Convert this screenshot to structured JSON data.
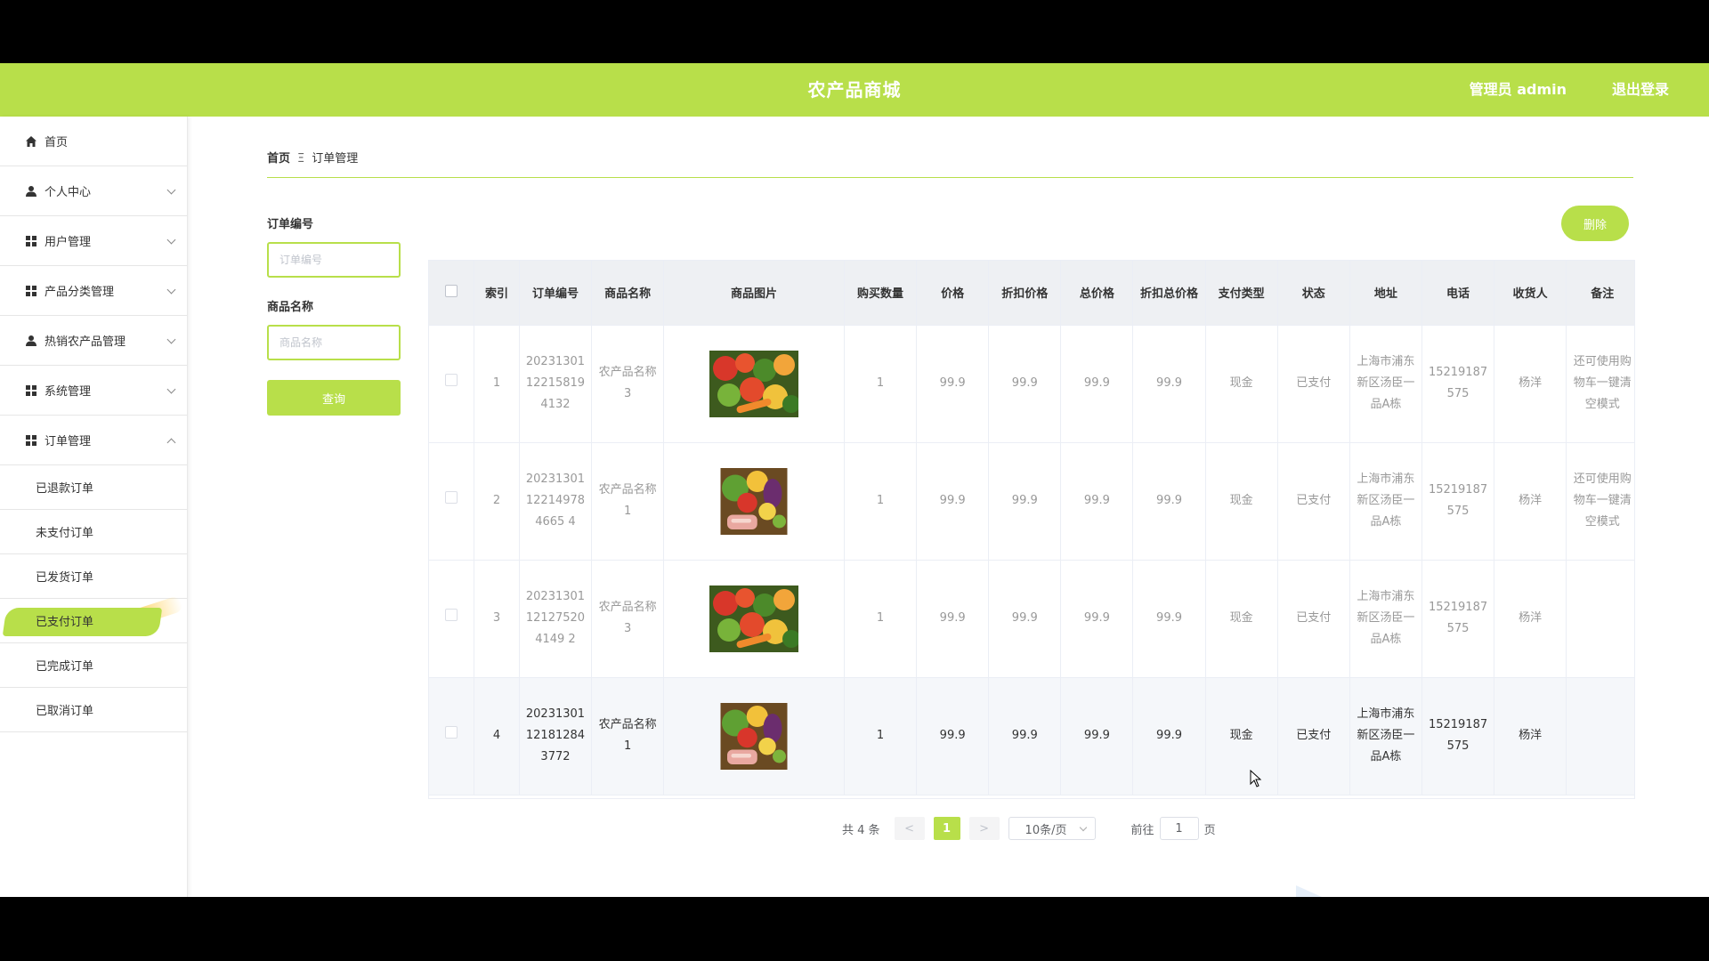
{
  "header": {
    "title": "农产品商城",
    "admin_label": "管理员 admin",
    "logout": "退出登录"
  },
  "sidebar": {
    "items": [
      {
        "label": "首页",
        "icon": "home-icon",
        "arrow": false
      },
      {
        "label": "个人中心",
        "icon": "user-icon",
        "arrow": true
      },
      {
        "label": "用户管理",
        "icon": "grid-icon",
        "arrow": true
      },
      {
        "label": "产品分类管理",
        "icon": "grid-icon",
        "arrow": true
      },
      {
        "label": "热销农产品管理",
        "icon": "user-icon",
        "arrow": true
      },
      {
        "label": "系统管理",
        "icon": "grid-icon",
        "arrow": true
      },
      {
        "label": "订单管理",
        "icon": "grid-icon",
        "arrow": true,
        "expanded": true
      }
    ],
    "subitems": [
      "已退款订单",
      "未支付订单",
      "已发货订单",
      "已支付订单",
      "已完成订单",
      "已取消订单"
    ],
    "active_sub": 3
  },
  "breadcrumb": {
    "home": "首页",
    "separator": "Ξ",
    "current": "订单管理"
  },
  "filter": {
    "order_no_label": "订单编号",
    "order_no_placeholder": "订单编号",
    "product_label": "商品名称",
    "product_placeholder": "商品名称",
    "query_button": "查询"
  },
  "delete_button": "删除",
  "table": {
    "headers": [
      "索引",
      "订单编号",
      "商品名称",
      "商品图片",
      "购买数量",
      "价格",
      "折扣价格",
      "总价格",
      "折扣总价格",
      "支付类型",
      "状态",
      "地址",
      "电话",
      "收货人",
      "备注"
    ],
    "rows": [
      {
        "index": "1",
        "order_no": "20231301122158194132",
        "product": "农产品名称3",
        "image": "vegetables-image-a",
        "qty": "1",
        "price": "99.9",
        "discount_price": "99.9",
        "total": "99.9",
        "discount_total": "99.9",
        "pay_type": "现金",
        "status": "已支付",
        "address": "上海市浦东新区汤臣一品A栋",
        "phone": "15219187575",
        "receiver": "杨洋",
        "remark": "还可使用购物车一键清空模式"
      },
      {
        "index": "2",
        "order_no": "20231301122149784665 4",
        "product": "农产品名称1",
        "image": "vegetables-image-b",
        "qty": "1",
        "price": "99.9",
        "discount_price": "99.9",
        "total": "99.9",
        "discount_total": "99.9",
        "pay_type": "现金",
        "status": "已支付",
        "address": "上海市浦东新区汤臣一品A栋",
        "phone": "15219187575",
        "receiver": "杨洋",
        "remark": "还可使用购物车一键清空模式"
      },
      {
        "index": "3",
        "order_no": "20231301121275204149 2",
        "product": "农产品名称3",
        "image": "vegetables-image-a",
        "qty": "1",
        "price": "99.9",
        "discount_price": "99.9",
        "total": "99.9",
        "discount_total": "99.9",
        "pay_type": "现金",
        "status": "已支付",
        "address": "上海市浦东新区汤臣一品A栋",
        "phone": "15219187575",
        "receiver": "杨洋",
        "remark": ""
      },
      {
        "index": "4",
        "order_no": "20231301121812843772",
        "product": "农产品名称1",
        "image": "vegetables-image-b",
        "qty": "1",
        "price": "99.9",
        "discount_price": "99.9",
        "total": "99.9",
        "discount_total": "99.9",
        "pay_type": "现金",
        "status": "已支付",
        "address": "上海市浦东新区汤臣一品A栋",
        "phone": "15219187575",
        "receiver": "杨洋",
        "remark": ""
      }
    ]
  },
  "pager": {
    "total": "共 4 条",
    "prev": "<",
    "current": "1",
    "next": ">",
    "page_size": "10条/页",
    "goto_prefix": "前往",
    "goto_value": "1",
    "goto_suffix": "页"
  },
  "colors": {
    "accent": "#b8df4a",
    "header_bg": "#b8df4a"
  }
}
